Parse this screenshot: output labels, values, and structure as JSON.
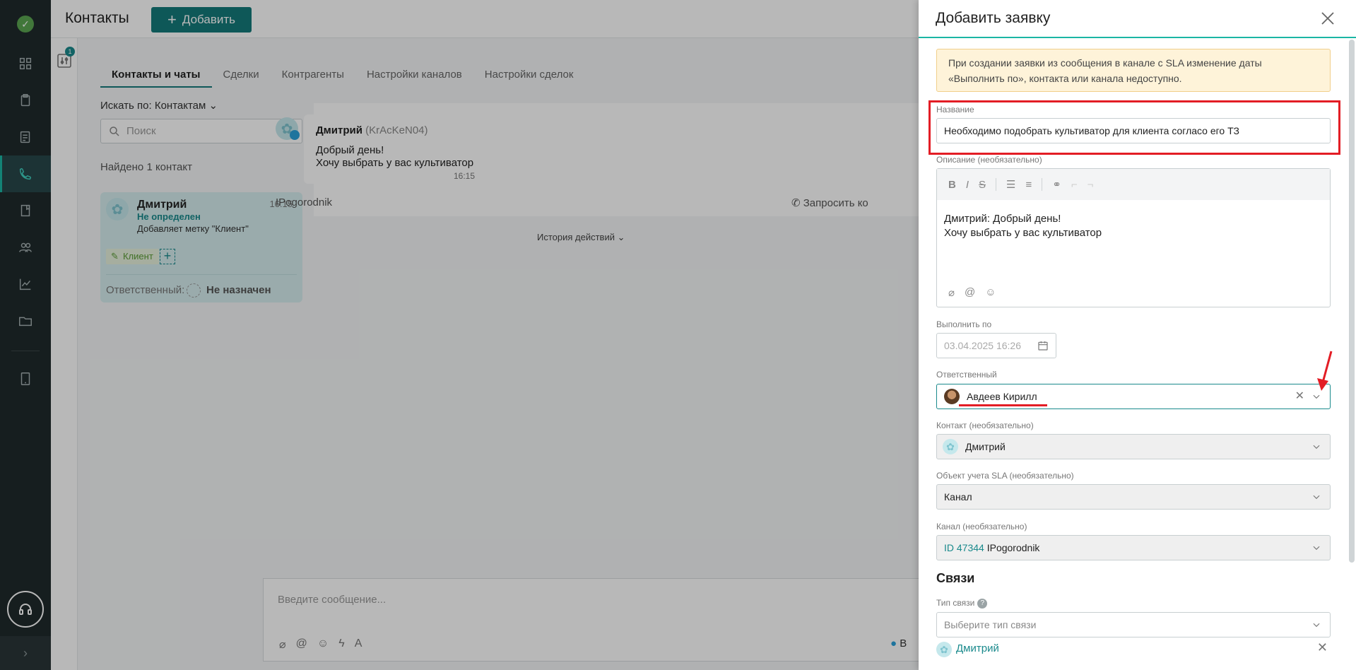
{
  "app": {
    "page_title": "Контакты",
    "add_button": "Добавить",
    "filter_badge": "1",
    "tabs": [
      {
        "label": "Контакты и чаты"
      },
      {
        "label": "Сделки"
      },
      {
        "label": "Контрагенты"
      },
      {
        "label": "Настройки каналов"
      },
      {
        "label": "Настройки сделок"
      }
    ],
    "search_by": "Искать по: Контактам",
    "search_placeholder": "Поиск",
    "found_count": "Найдено 1 контакт",
    "contact_card": {
      "name": "Дмитрий",
      "time": "16:15",
      "status": "Не определен",
      "sub": "Добавляет метку \"Клиент\"",
      "tag": "Клиент",
      "responsible_label": "Ответственный:",
      "responsible_value": "Не назначен"
    },
    "message": {
      "author": "Дмитрий",
      "author_handle": "(KrAcKeN04)",
      "line1": "Добрый день!",
      "line2": "Хочу выбрать у вас культиватор",
      "time": "16:15"
    },
    "channel_name": "IPogorodnik",
    "request_contact": "Запросить ко",
    "history": "История действий",
    "composer_placeholder": "Введите сообщение...",
    "composer_send_label": "В"
  },
  "drawer": {
    "title": "Добавить заявку",
    "warning": "При создании заявки из сообщения в канале с SLA изменение даты «Выполнить по», контакта или канала недоступно.",
    "name_label": "Название",
    "name_value": "Необходимо подобрать культиватор для клиента согласо его ТЗ",
    "description_label": "Описание (необязательно)",
    "description_line1": "Дмитрий: Добрый день!",
    "description_line2": "Хочу выбрать у вас культиватор",
    "due_label": "Выполнить по",
    "due_value": "03.04.2025 16:26",
    "responsible_label": "Ответственный",
    "responsible_value": "Авдеев Кирилл",
    "contact_label": "Контакт (необязательно)",
    "contact_value": "Дмитрий",
    "sla_label": "Объект учета SLA (необязательно)",
    "sla_value": "Канал",
    "channel_label": "Канал (необязательно)",
    "channel_id": "ID 47344",
    "channel_value": "IPogorodnik",
    "links_title": "Связи",
    "link_type_label": "Тип связи",
    "link_type_placeholder": "Выберите тип связи",
    "linked_contact": "Дмитрий"
  },
  "colors": {
    "accent": "#147a7b",
    "highlight": "#e31d25",
    "rail": "#1f2a2c"
  }
}
